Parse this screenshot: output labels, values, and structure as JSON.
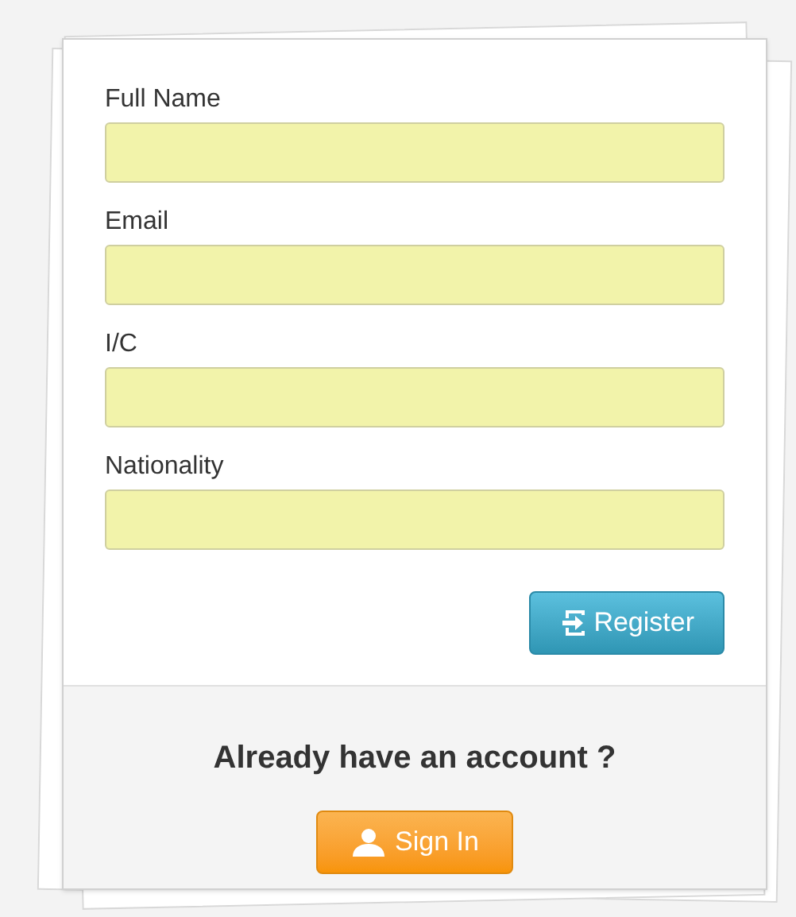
{
  "form": {
    "fields": [
      {
        "label": "Full Name"
      },
      {
        "label": "Email"
      },
      {
        "label": "I/C"
      },
      {
        "label": "Nationality"
      }
    ],
    "submit": {
      "label": "Register"
    }
  },
  "footer": {
    "prompt": "Already have an account ?",
    "sign_in": {
      "label": "Sign In"
    }
  }
}
